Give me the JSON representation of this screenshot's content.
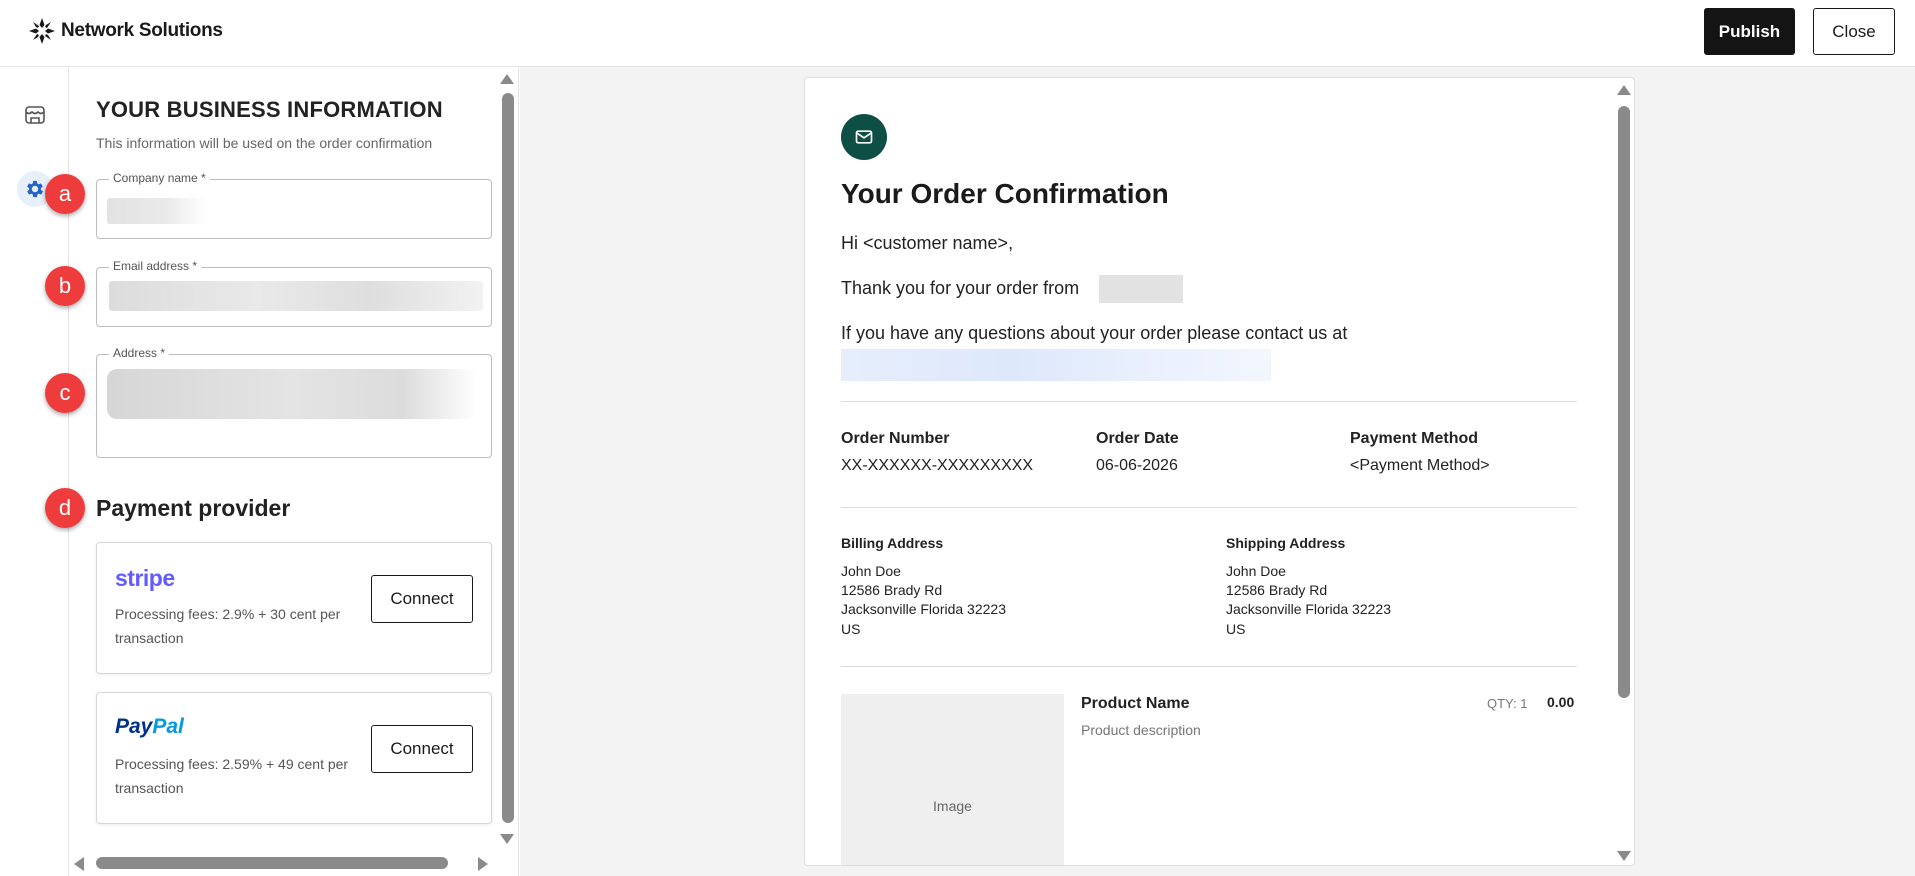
{
  "brand": {
    "name": "Network Solutions"
  },
  "header": {
    "publish_label": "Publish",
    "close_label": "Close"
  },
  "rail": {
    "items": [
      "storefront-icon",
      "gear-icon"
    ]
  },
  "business": {
    "title": "YOUR BUSINESS INFORMATION",
    "subtitle": "This information will be used on the order confirmation",
    "company_label": "Company name *",
    "email_label": "Email address *",
    "address_label": "Address *"
  },
  "payment": {
    "title": "Payment provider",
    "providers": [
      {
        "logo": "stripe",
        "fees": "Processing fees: 2.9% + 30 cent per transaction",
        "button": "Connect"
      },
      {
        "logo_main": "Pay",
        "logo_accent": "Pal",
        "fees": "Processing fees: 2.59% + 49 cent per transaction",
        "button": "Connect"
      }
    ]
  },
  "markers": [
    "a",
    "b",
    "c",
    "d"
  ],
  "email": {
    "title": "Your Order Confirmation",
    "greeting": "Hi <customer name>,",
    "thanks": "Thank you for your order from",
    "questions": "If you have any questions about your order please contact us at",
    "order_number_label": "Order Number",
    "order_number": "XX-XXXXXX-XXXXXXXXX",
    "order_date_label": "Order Date",
    "order_date": "06-06-2026",
    "payment_method_label": "Payment Method",
    "payment_method": "<Payment Method>",
    "billing": {
      "label": "Billing Address",
      "lines": [
        "John Doe",
        "12586 Brady Rd",
        "Jacksonville Florida 32223",
        "US"
      ]
    },
    "shipping": {
      "label": "Shipping Address",
      "lines": [
        "John Doe",
        "12586 Brady Rd",
        "Jacksonville Florida 32223",
        "US"
      ]
    },
    "product": {
      "image_label": "Image",
      "name": "Product Name",
      "description": "Product description",
      "qty": "QTY: 1",
      "price": "0.00"
    }
  },
  "colors": {
    "accent": "#ee3b3b",
    "mail_badge": "#0e4f45",
    "stripe": "#635bff",
    "paypal_dark": "#003087",
    "paypal_light": "#009cde"
  }
}
